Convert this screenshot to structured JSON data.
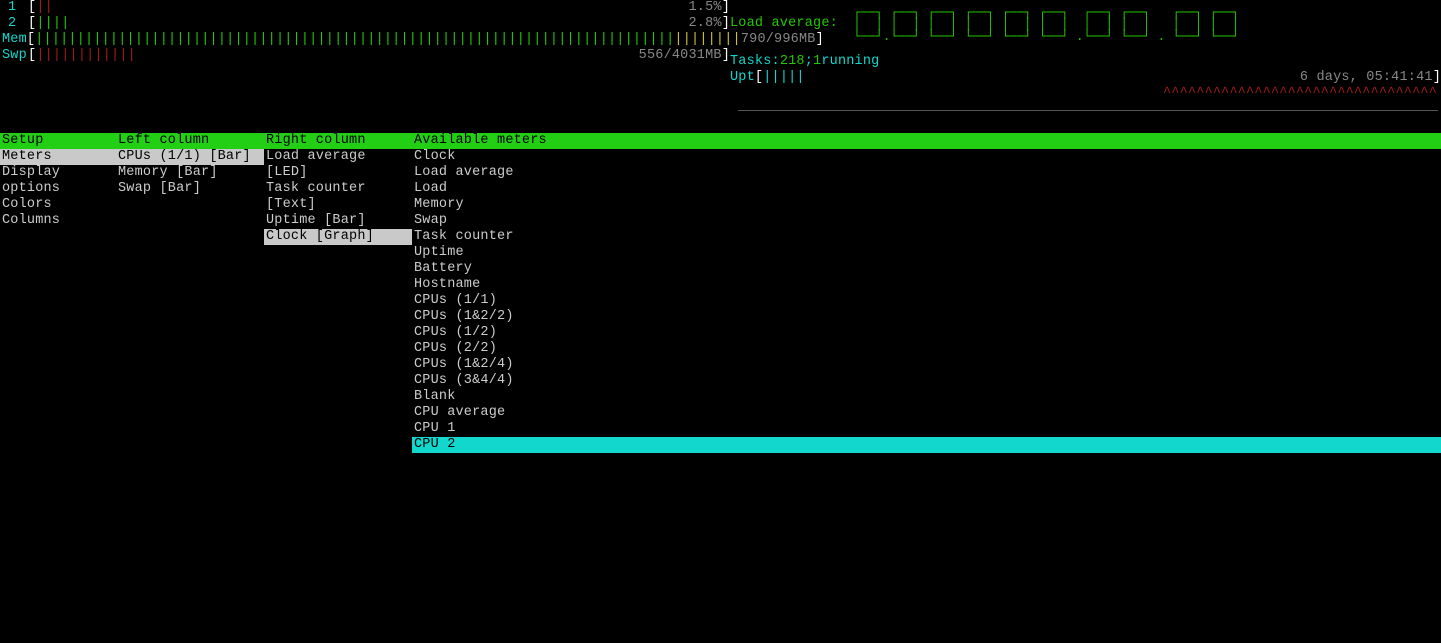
{
  "cpu1": {
    "label": "1",
    "bar": "||",
    "value": "1.5%"
  },
  "cpu2": {
    "label": "2",
    "bar": "||||",
    "value": "2.8%"
  },
  "mem": {
    "label": "Mem",
    "green": "|||||||||||||||||||||||||||||||||||||||||||||||||||||||||||||||||||||||||||||",
    "blue": "",
    "yellow": "||||||||",
    "value": "790/996MB"
  },
  "swp": {
    "label": "Swp",
    "red": "||||||||||||",
    "value": "556/4031MB"
  },
  "load_label": "Load average:",
  "tasks_label": "Tasks: ",
  "tasks_count": "218",
  "tasks_sep": "; ",
  "tasks_run": "1",
  "tasks_run_suffix": " running",
  "upt_label": "Upt",
  "upt_bar": "|||||",
  "uptime_value": "6 days, 05:41:41",
  "carets": "^^^^^^^^^^^^^^^^^^^^^^^^^^^^^^^^^",
  "setup": {
    "header": "Setup",
    "items": [
      {
        "label": "Meters",
        "selected": true
      },
      {
        "label": "Display options"
      },
      {
        "label": "Colors"
      },
      {
        "label": "Columns"
      }
    ]
  },
  "left_col": {
    "header": "Left column",
    "items": [
      {
        "label": "CPUs (1/1) [Bar]",
        "selected": true
      },
      {
        "label": "Memory [Bar]"
      },
      {
        "label": "Swap [Bar]"
      }
    ]
  },
  "right_col": {
    "header": "Right column",
    "items": [
      {
        "label": "Load average [LED]"
      },
      {
        "label": "Task counter [Text]"
      },
      {
        "label": "Uptime [Bar]"
      },
      {
        "label": "Clock [Graph]",
        "selected": true
      }
    ]
  },
  "avail": {
    "header": "Available meters",
    "items": [
      {
        "label": "Clock"
      },
      {
        "label": "Load average"
      },
      {
        "label": "Load"
      },
      {
        "label": "Memory"
      },
      {
        "label": "Swap"
      },
      {
        "label": "Task counter"
      },
      {
        "label": "Uptime"
      },
      {
        "label": "Battery"
      },
      {
        "label": "Hostname"
      },
      {
        "label": "CPUs (1/1)"
      },
      {
        "label": "CPUs (1&2/2)"
      },
      {
        "label": "CPUs (1/2)"
      },
      {
        "label": "CPUs (2/2)"
      },
      {
        "label": "CPUs (1&2/4)"
      },
      {
        "label": "CPUs (3&4/4)"
      },
      {
        "label": "Blank"
      },
      {
        "label": "CPU average"
      },
      {
        "label": "CPU 1"
      },
      {
        "label": "CPU 2",
        "selected_cyan": true
      }
    ]
  }
}
